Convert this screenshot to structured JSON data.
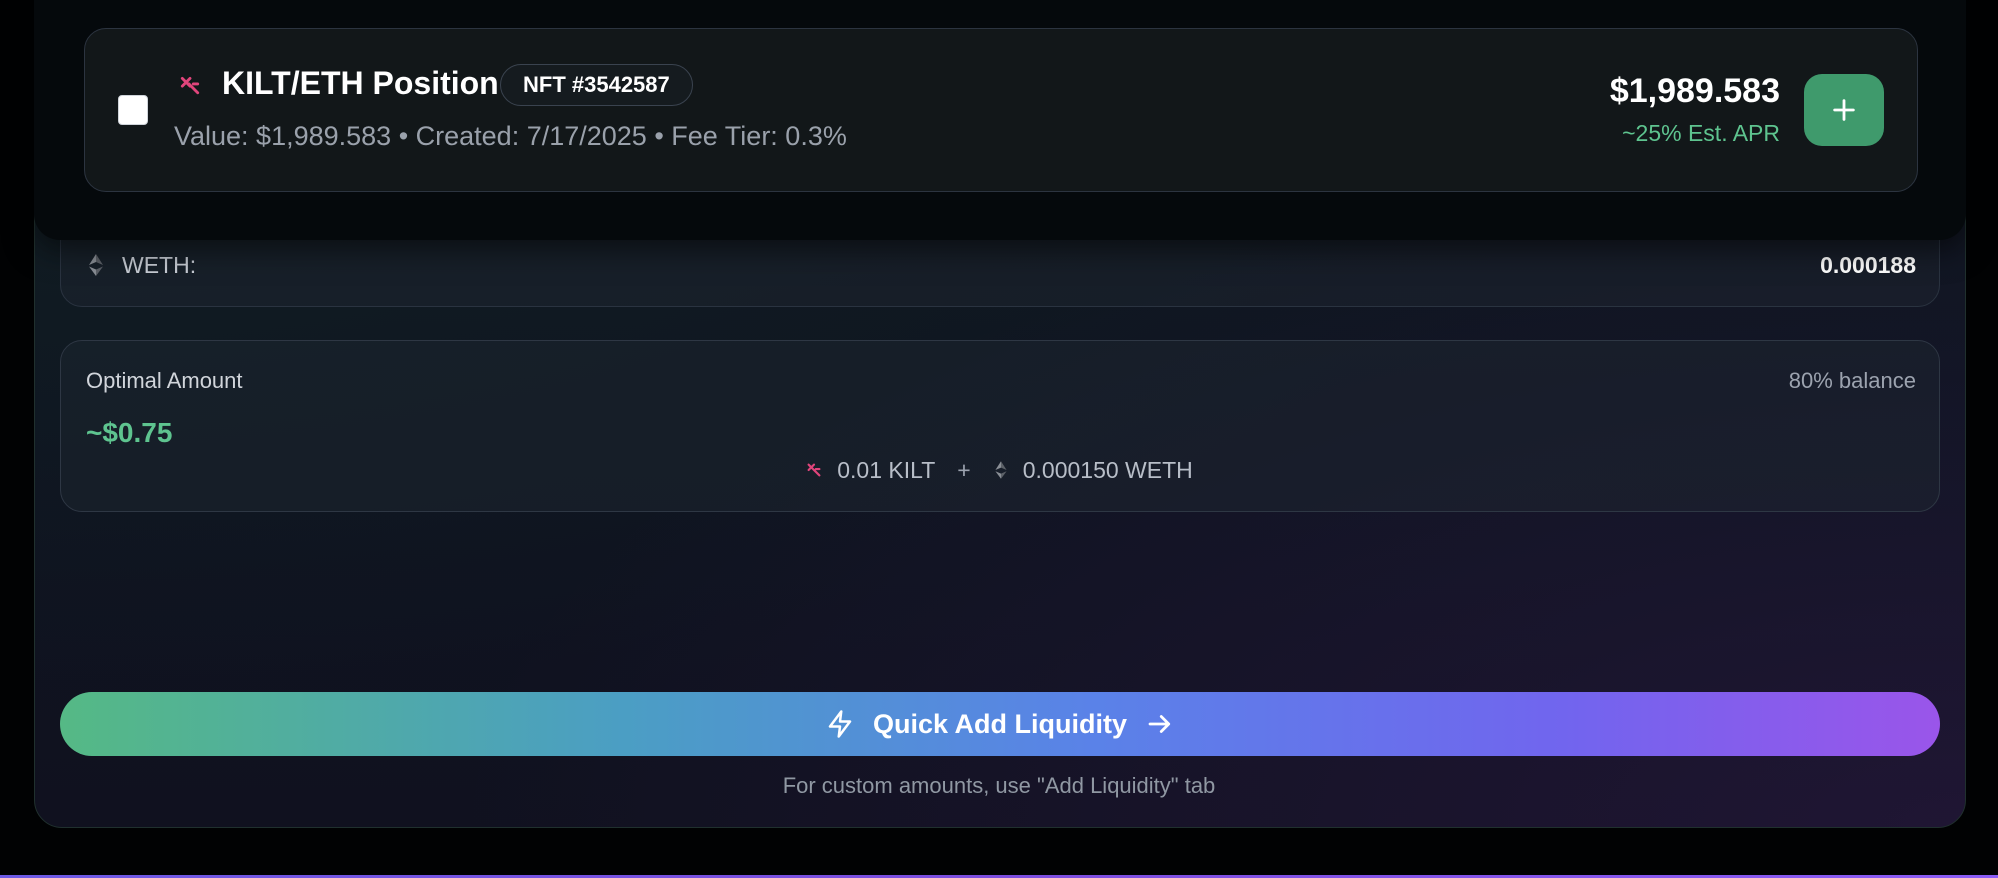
{
  "position": {
    "title": "KILT/ETH Position",
    "nft_badge": "NFT #3542587",
    "meta": "Value: $1,989.583 • Created: 7/17/2025 • Fee Tier: 0.3%",
    "value": "$1,989.583",
    "apr": "~25% Est. APR",
    "add_button_icon": "plus-icon",
    "checked": false
  },
  "balances": {
    "weth_label": "WETH:",
    "weth_value": "0.000188"
  },
  "optimal": {
    "title": "Optimal Amount",
    "balance_pct": "80% balance",
    "usd": "~$0.75",
    "kilt_amount": "0.01 KILT",
    "plus": "+",
    "weth_amount": "0.000150 WETH"
  },
  "quick_add": {
    "label": "Quick Add Liquidity",
    "hint": "For custom amounts, use \"Add Liquidity\" tab"
  },
  "colors": {
    "accent_green": "#5ec48f",
    "kilt_pink": "#e0457b",
    "button_gradient_start": "#55b985",
    "button_gradient_end": "#9a55ea"
  }
}
